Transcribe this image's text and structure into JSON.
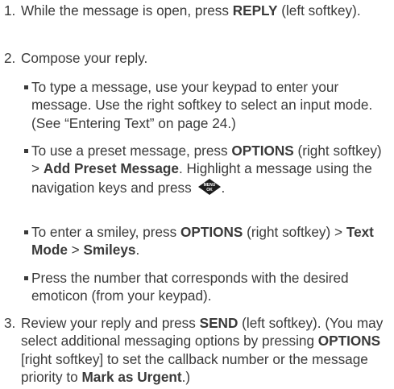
{
  "steps": [
    {
      "number": "1.",
      "t1": "While the message is open, press ",
      "k1": "REPLY",
      "t2": " (left softkey)."
    },
    {
      "number": "2.",
      "t1": "Compose your reply."
    },
    {
      "number": "3.",
      "t1": "Review your reply and press ",
      "k1": "SEND",
      "t2": " (left softkey). (You may select additional messaging options by pressing ",
      "k2": "OPTIONS",
      "t3": " [right softkey] to set the callback number or the message priority to ",
      "k3": "Mark as Urgent",
      "t4": ".)"
    }
  ],
  "substeps": [
    {
      "t1": "To type a message, use your keypad to enter your message. Use the right softkey to select an input mode. (See “Entering Text” on page 24.)"
    },
    {
      "t1": "To use a preset message, press ",
      "k1": "OPTIONS",
      "t2": " (right softkey) > ",
      "k2": "Add Preset Message",
      "t3": ". Highlight a message using the navigation keys and press ",
      "icon": "menu-ok-key-icon",
      "icon_top": "MENU",
      "icon_bottom": "OK",
      "t4": "."
    },
    {
      "t1": "To enter a smiley, press ",
      "k1": "OPTIONS",
      "t2": " (right softkey) > ",
      "k2": "Text Mode",
      "t3": " > ",
      "k3": "Smileys",
      "t4": "."
    },
    {
      "t1": "Press the number that corresponds with the desired emoticon (from your keypad)."
    }
  ]
}
